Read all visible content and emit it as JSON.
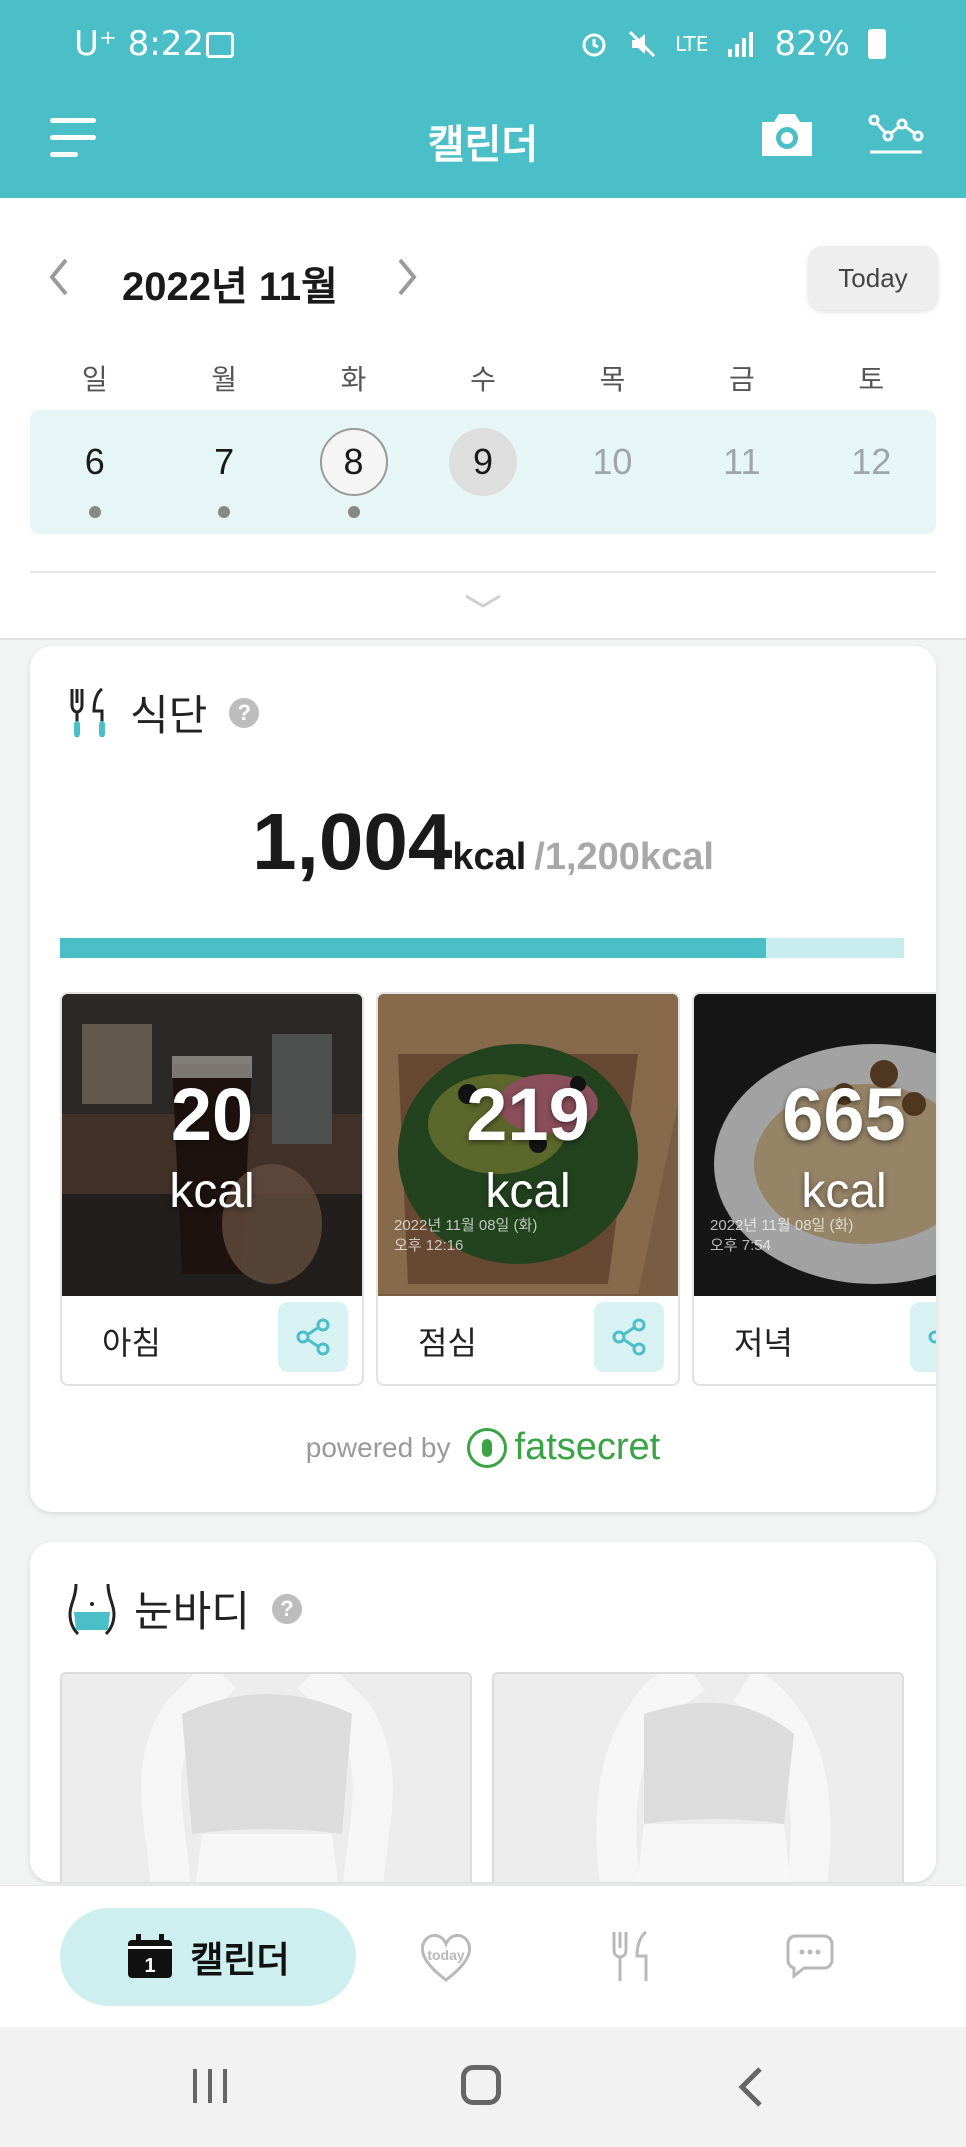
{
  "status_bar": {
    "carrier": "U⁺",
    "time": "8:22",
    "network": "LTE",
    "battery": "82%"
  },
  "header": {
    "title": "캘린더",
    "icons": [
      "menu-icon",
      "camera-icon",
      "graph-icon"
    ]
  },
  "calendar": {
    "month_label": "2022년 11월",
    "today_button": "Today",
    "weekdays": [
      "일",
      "월",
      "화",
      "수",
      "목",
      "금",
      "토"
    ],
    "days": [
      {
        "num": "6",
        "dot": true,
        "state": "past"
      },
      {
        "num": "7",
        "dot": true,
        "state": "past"
      },
      {
        "num": "8",
        "dot": true,
        "state": "selected"
      },
      {
        "num": "9",
        "dot": false,
        "state": "today"
      },
      {
        "num": "10",
        "dot": false,
        "state": "future"
      },
      {
        "num": "11",
        "dot": false,
        "state": "future"
      },
      {
        "num": "12",
        "dot": false,
        "state": "future"
      }
    ]
  },
  "diet": {
    "title": "식단",
    "help": "?",
    "total_kcal": "1,004",
    "unit": "kcal",
    "goal": "/1,200kcal",
    "progress_fraction": 0.837,
    "meals": [
      {
        "name": "아침",
        "kcal": "20",
        "unit": "kcal",
        "stamp": ""
      },
      {
        "name": "점심",
        "kcal": "219",
        "unit": "kcal",
        "stamp": "2022년 11월 08일 (화)\n오후 12:16"
      },
      {
        "name": "저녁",
        "kcal": "665",
        "unit": "kcal",
        "stamp": "2022년 11월 08일 (화)\n오후 7:54"
      }
    ],
    "powered_by": "powered by",
    "brand": "fatsecret"
  },
  "body": {
    "title": "눈바디",
    "help": "?"
  },
  "bottom_nav": {
    "active_label": "캘린더",
    "calendar_icon_day": "1",
    "today_icon_text": "today"
  },
  "colors": {
    "accent": "#4bbfc7",
    "accent_light": "#cdeff0",
    "brand_green": "#3aa346"
  }
}
